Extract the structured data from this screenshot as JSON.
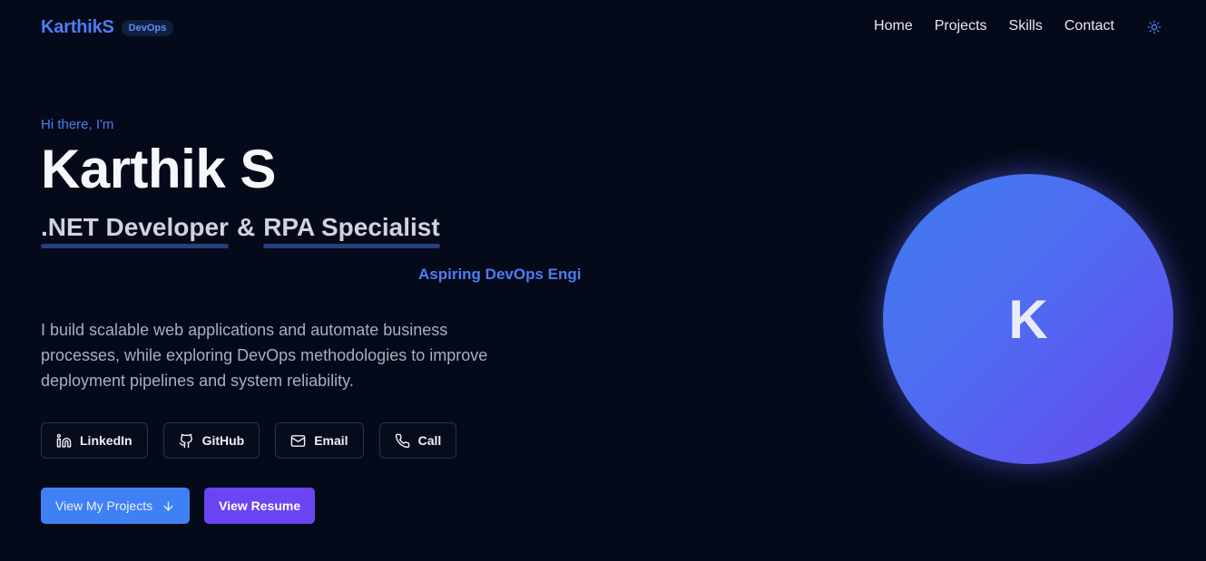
{
  "brand": {
    "name": "KarthikS",
    "badge": "DevOps"
  },
  "nav": {
    "items": [
      "Home",
      "Projects",
      "Skills",
      "Contact"
    ]
  },
  "theme_toggle_icon": "sun-icon",
  "hero": {
    "greeting": "Hi there, I'm",
    "name": "Karthik S",
    "role1": ".NET Developer",
    "amp": "&",
    "role2": "RPA Specialist",
    "aspiring": "Aspiring DevOps Engi",
    "description": "I build scalable web applications and automate business processes, while exploring DevOps methodologies to improve deployment pipelines and system reliability."
  },
  "social": [
    {
      "label": "LinkedIn",
      "icon": "linkedin-icon"
    },
    {
      "label": "GitHub",
      "icon": "github-icon"
    },
    {
      "label": "Email",
      "icon": "mail-icon"
    },
    {
      "label": "Call",
      "icon": "phone-icon"
    }
  ],
  "cta": {
    "primary": "View My Projects",
    "primary_icon": "arrow-down-icon",
    "secondary": "View Resume"
  },
  "avatar": {
    "letter": "K"
  },
  "colors": {
    "background": "#050a1a",
    "accent_blue": "#4e7cf3",
    "primary_button": "#3f81f4",
    "secondary_button": "#6a45f1"
  }
}
